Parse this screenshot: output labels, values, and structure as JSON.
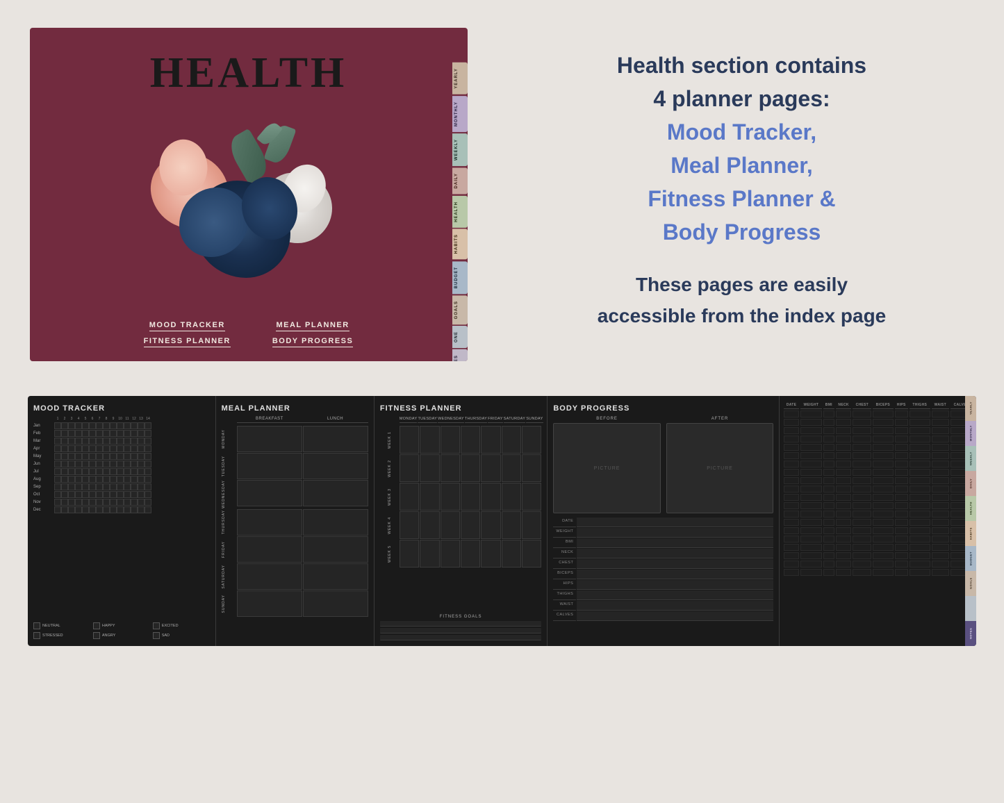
{
  "cover": {
    "title": "HEALTH",
    "labels": {
      "col1": [
        "MOOD TRACKER",
        "FITNESS PLANNER"
      ],
      "col2": [
        "MEAL PLANNER",
        "BODY PROGRESS"
      ]
    },
    "tabs": [
      "YEARLY",
      "MONTHLY",
      "WEEKLY",
      "DAILY",
      "HEALTH",
      "HABITS",
      "BUDGET",
      "GOALS",
      "ONE",
      "NOTES"
    ]
  },
  "description": {
    "line1": "Health section contains",
    "line2": "4 planner pages:",
    "features": [
      "Mood Tracker,",
      "Meal Planner,",
      "Fitness Planner &",
      "Body Progress"
    ],
    "note1": "These pages are easily",
    "note2": "accessible from the index page"
  },
  "pages": {
    "mood": {
      "title": "MOOD TRACKER",
      "months": [
        "Jan",
        "Feb",
        "Mar",
        "Apr",
        "May",
        "Jun",
        "Jul",
        "Aug",
        "Sep",
        "Oct",
        "Nov",
        "Dec"
      ],
      "days": [
        "1",
        "2",
        "3",
        "4",
        "5",
        "6",
        "7",
        "8",
        "9",
        "10",
        "11",
        "12",
        "13",
        "14"
      ],
      "legend": [
        "NEUTRAL",
        "HAPPY",
        "EXCITED",
        "STRESSED",
        "ANGRY",
        "SAD"
      ]
    },
    "meal": {
      "title": "MEAL PLANNER",
      "columns": [
        "BREAKFAST",
        "LUNCH"
      ],
      "days": [
        "MONDAY",
        "TUESDAY",
        "WEDNESDAY",
        "THURSDAY",
        "FRIDAY",
        "SATURDAY",
        "SUNDAY"
      ]
    },
    "fitness": {
      "title": "FITNESS PLANNER",
      "columns": [
        "MONDAY",
        "TUESDAY",
        "WEDNESDAY",
        "THURSDAY",
        "FRIDAY",
        "SATURDAY",
        "SUNDAY"
      ],
      "weeks": [
        "WEEK 1",
        "WEEK 2",
        "WEEK 3",
        "WEEK 4",
        "WEEK 5"
      ],
      "goals_title": "FITNESS GOALS"
    },
    "body": {
      "title": "BODY PROGRESS",
      "before_label": "BEFORE",
      "after_label": "AFTER",
      "before_photo_text": "PICTURE",
      "after_photo_text": "PICTURE",
      "measurements": [
        "DATE",
        "WEIGHT",
        "BMI",
        "NECK",
        "CHEST",
        "BICEPS",
        "HIPS",
        "THIGHS",
        "WAIST",
        "CALVES"
      ]
    },
    "tracking": {
      "columns": [
        "DATE",
        "WEIGHT",
        "BMI",
        "NECK",
        "CHEST",
        "BICEPS",
        "HIPS",
        "THIGHS",
        "WAIST",
        "CALVES"
      ]
    }
  },
  "bottom_tabs": [
    "YEARLY",
    "MONTHLY",
    "WEEKLY",
    "DAILY",
    "HEALTH",
    "HABITS",
    "BUDGET",
    "GOALS",
    "",
    "NOTES"
  ]
}
